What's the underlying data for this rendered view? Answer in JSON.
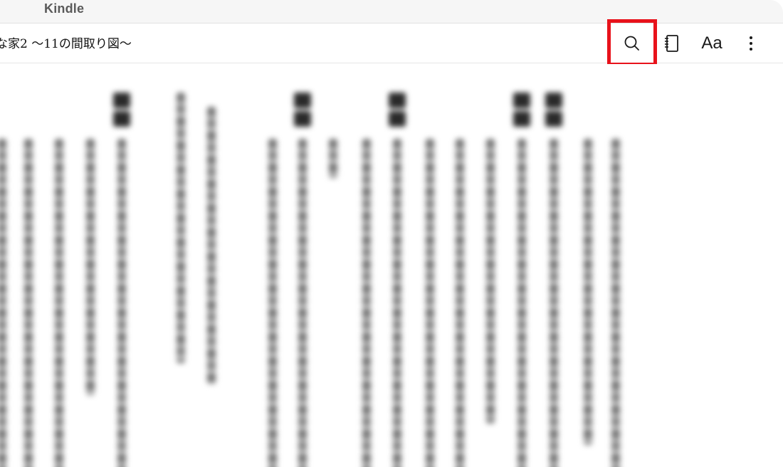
{
  "window": {
    "app_name": "Kindle"
  },
  "toolbar": {
    "book_title": "な家2 〜11の間取り図〜",
    "buttons": {
      "search_icon": "search-icon",
      "notebook_icon": "notebook-icon",
      "font_label": "Aa",
      "more_icon": "more-vertical-icon"
    },
    "highlight_color": "#e8121b"
  }
}
